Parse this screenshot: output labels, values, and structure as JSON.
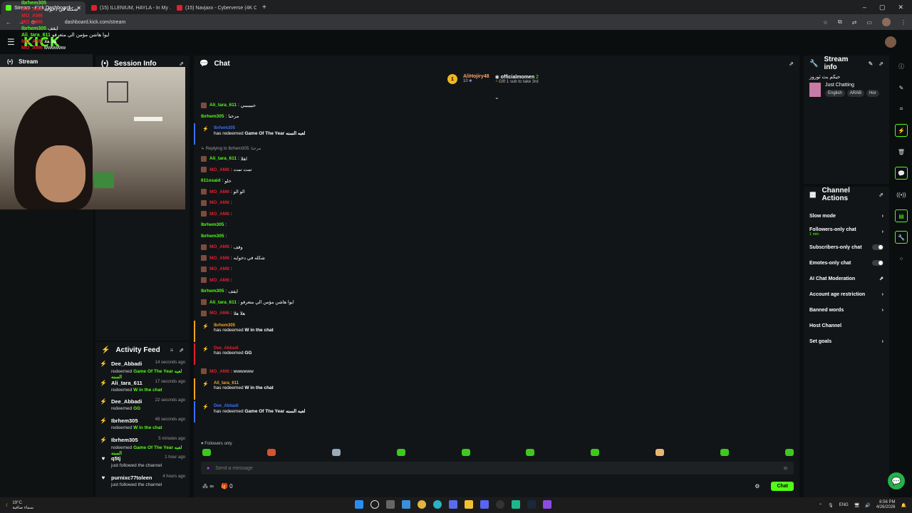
{
  "browser": {
    "tabs": [
      {
        "title": "Stream - Kick Dashboard",
        "color": "#53fc18",
        "active": true
      },
      {
        "title": "(15) ILLENIUM, HAYLA - In My ...",
        "color": "#e02030",
        "active": false
      },
      {
        "title": "(15) Navjaxx - Cyberverse (4K C...",
        "color": "#e02030",
        "active": false
      }
    ],
    "url": "dashboard.kick.com/stream"
  },
  "header": {
    "logo": "KICK"
  },
  "leftnav": {
    "label": "Stream"
  },
  "overlay_chat": [
    {
      "name": "Ibrhem305",
      "text": "",
      "color": "green"
    },
    {
      "name": "MO_AM6",
      "text": "شكله في دخوايه",
      "color": "red"
    },
    {
      "name": "MO_AM6",
      "text": "",
      "color": "red"
    },
    {
      "name": "MO_AM6",
      "text": "",
      "color": "red"
    },
    {
      "name": "Ibrhem305",
      "text": "ايقف",
      "color": "green"
    },
    {
      "name": "Ali_tara_611",
      "text": "ايوا هاشن مؤمن الي متعرفو",
      "color": "green"
    },
    {
      "name": "MO_AM6",
      "text": "هلا هلا",
      "color": "red"
    },
    {
      "name": "MO_AM6",
      "text": "wwwwww",
      "color": "red"
    }
  ],
  "session": {
    "title": "Session Info"
  },
  "activity": {
    "title": "Activity Feed",
    "items": [
      {
        "icon": "bolt",
        "name": "Dee_Abbadi",
        "time": "14 seconds ago",
        "action": "redeemed",
        "reward": "Game Of The Year لعبه السنه"
      },
      {
        "icon": "bolt",
        "name": "Ali_tara_611",
        "time": "17 seconds ago",
        "action": "redeemed",
        "reward": "W in the chat"
      },
      {
        "icon": "bolt",
        "name": "Dee_Abbadi",
        "time": "22 seconds ago",
        "action": "redeemed",
        "reward": "GG"
      },
      {
        "icon": "bolt",
        "name": "Ibrhem305",
        "time": "48 seconds ago",
        "action": "redeemed",
        "reward": "W in the chat"
      },
      {
        "icon": "bolt",
        "name": "Ibrhem305",
        "time": "5 minutes ago",
        "action": "redeemed",
        "reward": "Game Of The Year لعبه السنه"
      },
      {
        "icon": "heart",
        "name": "q5tj",
        "time": "1 hour ago",
        "action": "just followed the channel",
        "reward": ""
      },
      {
        "icon": "heart",
        "name": "purnixc77toleen",
        "time": "4 hours ago",
        "action": "just followed the channel",
        "reward": ""
      }
    ]
  },
  "chat": {
    "title": "Chat",
    "pinned": {
      "name1": "AliHojiry48",
      "count1": "10",
      "name2": "officialmomen",
      "count2": "2",
      "sub": "Gift 1 sub to take 3rd"
    },
    "messages": [
      {
        "type": "msg",
        "name": "Ali_tara_611",
        "text": "حبيببببي",
        "color": "green",
        "avatar": true
      },
      {
        "type": "msg",
        "name": "Ibrhem305",
        "text": "مرحبا",
        "color": "green",
        "avatar": false
      },
      {
        "type": "redeem",
        "name": "Ibrhem305",
        "text": "has redeemed",
        "reward": "Game Of The Year لعبه السنه",
        "style": "blue"
      },
      {
        "type": "reply",
        "text": "Replying to Ibrhem305: مرحبا"
      },
      {
        "type": "msg",
        "name": "Ali_tara_611",
        "text": "اهلا",
        "color": "green",
        "avatar": true
      },
      {
        "type": "msg",
        "name": "MO_AM6",
        "text": "تمت تمت",
        "color": "red",
        "avatar": true
      },
      {
        "type": "msg",
        "name": "611osaid",
        "text": "حلو",
        "color": "green",
        "avatar": false
      },
      {
        "type": "msg",
        "name": "MO_AM6",
        "text": "الو الو",
        "color": "red",
        "avatar": true
      },
      {
        "type": "msg",
        "name": "MO_AM6",
        "text": "",
        "color": "red",
        "avatar": true
      },
      {
        "type": "msg",
        "name": "MO_AM6",
        "text": "",
        "color": "red",
        "avatar": true
      },
      {
        "type": "msg",
        "name": "Ibrhem305",
        "text": "",
        "color": "green",
        "avatar": false
      },
      {
        "type": "msg",
        "name": "Ibrhem305",
        "text": "",
        "color": "green",
        "avatar": false
      },
      {
        "type": "msg",
        "name": "MO_AM6",
        "text": "وقف",
        "color": "red",
        "avatar": true
      },
      {
        "type": "msg",
        "name": "MO_AM6",
        "text": "شكله في دخوايه",
        "color": "red",
        "avatar": true
      },
      {
        "type": "msg",
        "name": "MO_AM6",
        "text": "",
        "color": "red",
        "avatar": true
      },
      {
        "type": "msg",
        "name": "MO_AM6",
        "text": "",
        "color": "red",
        "avatar": true
      },
      {
        "type": "msg",
        "name": "Ibrhem305",
        "text": "ايقف",
        "color": "green",
        "avatar": false
      },
      {
        "type": "msg",
        "name": "Ali_tara_611",
        "text": "ايوا هاشن مؤمن الي متعرفو",
        "color": "green",
        "avatar": true
      },
      {
        "type": "msg",
        "name": "MO_AM6",
        "text": "هلا هلا",
        "color": "red",
        "avatar": true
      },
      {
        "type": "redeem",
        "name": "Ibrhem305",
        "text": "has redeemed",
        "reward": "W in the chat",
        "style": "orange"
      },
      {
        "type": "redeem",
        "name": "Dee_Abbadi",
        "text": "has redeemed",
        "reward": "GG",
        "style": "red"
      },
      {
        "type": "msg",
        "name": "MO_AM6",
        "text": "wwwwww",
        "color": "red",
        "avatar": true
      },
      {
        "type": "redeem",
        "name": "Ali_tara_611",
        "text": "has redeemed",
        "reward": "W in the chat",
        "style": "orange"
      },
      {
        "type": "redeem",
        "name": "Dee_Abbadi",
        "text": "has redeemed",
        "reward": "Game Of The Year لعبه السنه",
        "style": "blue"
      }
    ],
    "followers_only": "Followers only",
    "placeholder": "Send a message",
    "infinity_count": "∞",
    "gift_count": "0",
    "chat_button": "Chat"
  },
  "streaminfo": {
    "title": "Stream info",
    "stream_title": "حيكم بث ثوروز",
    "category": "Just Chatting",
    "tags": [
      "English",
      "ARAB",
      "Hor"
    ]
  },
  "channelactions": {
    "title": "Channel Actions",
    "items": [
      {
        "label": "Slow mode",
        "sub": "",
        "control": "chevron"
      },
      {
        "label": "Followers-only chat",
        "sub": "1 min",
        "control": "chevron"
      },
      {
        "label": "Subscribers-only chat",
        "sub": "",
        "control": "toggle"
      },
      {
        "label": "Emotes-only chat",
        "sub": "",
        "control": "toggle"
      },
      {
        "label": "AI Chat Moderation",
        "sub": "",
        "control": "external"
      },
      {
        "label": "Account age restriction",
        "sub": "",
        "control": "chevron"
      },
      {
        "label": "Banned words",
        "sub": "",
        "control": "chevron"
      },
      {
        "label": "Host Channel",
        "sub": "",
        "control": "none"
      },
      {
        "label": "Set goals",
        "sub": "",
        "control": "chevron"
      }
    ]
  },
  "taskbar": {
    "temp": "19°C",
    "weather": "سماء صافية",
    "lang": "ENG",
    "time": "8:56 PM",
    "date": "4/26/2026"
  }
}
